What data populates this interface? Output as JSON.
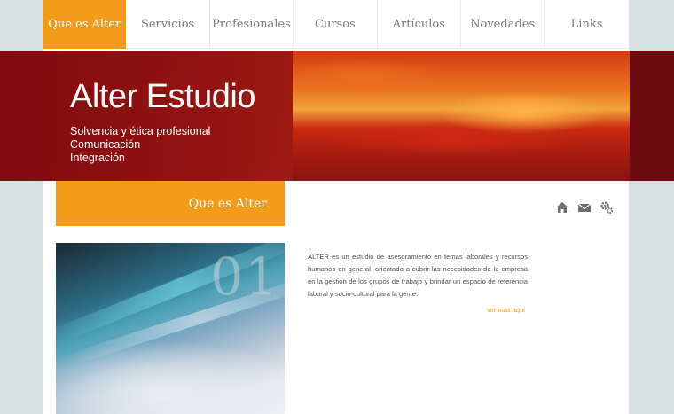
{
  "nav": {
    "items": [
      {
        "label": "Que es Alter",
        "active": true
      },
      {
        "label": "Servicios"
      },
      {
        "label": "Profesionales"
      },
      {
        "label": "Cursos"
      },
      {
        "label": "Artículos"
      },
      {
        "label": "Novedades"
      },
      {
        "label": "Links"
      }
    ]
  },
  "banner": {
    "title": "Alter Estudio",
    "lines": [
      "Solvencia y ética profesional",
      "Comunicación",
      "Integración"
    ]
  },
  "section": {
    "title": "Que es Alter"
  },
  "icons": [
    "home-icon",
    "mail-icon",
    "settings-icon"
  ],
  "card": {
    "number": "01"
  },
  "content": {
    "paragraph": "ALTER es un estudio de asesoramiento en temas laborales y recursos humanos en general, orientado a cubrir las necesidades de la empresa en la gestión de los grupos de trabajo y brindar un espacio de referencia laboral y socio-cultural para la gente.",
    "more_link": "ver mas aqui"
  },
  "colors": {
    "accent": "#f49b1a",
    "banner_dark": "#6c0a0d",
    "background": "#d7e2e3"
  }
}
